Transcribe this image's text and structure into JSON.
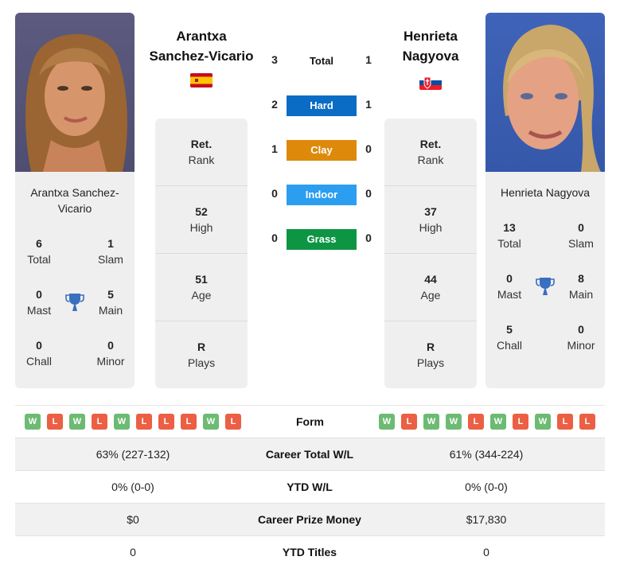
{
  "players": [
    {
      "name": "Arantxa Sanchez-Vicario",
      "name_header_line1": "Arantxa",
      "name_header_line2": "Sanchez-Vicario",
      "card_name": "Arantxa Sanchez-Vicario",
      "country_flag": "spain-flag",
      "titles": {
        "total": {
          "value": "6",
          "label": "Total"
        },
        "slam": {
          "value": "1",
          "label": "Slam"
        },
        "mast": {
          "value": "0",
          "label": "Mast"
        },
        "main": {
          "value": "5",
          "label": "Main"
        },
        "chall": {
          "value": "0",
          "label": "Chall"
        },
        "minor": {
          "value": "0",
          "label": "Minor"
        }
      },
      "info": {
        "rank": {
          "value": "Ret.",
          "label": "Rank"
        },
        "high": {
          "value": "52",
          "label": "High"
        },
        "age": {
          "value": "51",
          "label": "Age"
        },
        "plays": {
          "value": "R",
          "label": "Plays"
        }
      },
      "form": [
        "W",
        "L",
        "W",
        "L",
        "W",
        "L",
        "L",
        "L",
        "W",
        "L"
      ]
    },
    {
      "name": "Henrieta Nagyova",
      "name_header_line1": "Henrieta",
      "name_header_line2": "Nagyova",
      "card_name": "Henrieta Nagyova",
      "country_flag": "slovakia-flag",
      "titles": {
        "total": {
          "value": "13",
          "label": "Total"
        },
        "slam": {
          "value": "0",
          "label": "Slam"
        },
        "mast": {
          "value": "0",
          "label": "Mast"
        },
        "main": {
          "value": "8",
          "label": "Main"
        },
        "chall": {
          "value": "5",
          "label": "Chall"
        },
        "minor": {
          "value": "0",
          "label": "Minor"
        }
      },
      "info": {
        "rank": {
          "value": "Ret.",
          "label": "Rank"
        },
        "high": {
          "value": "37",
          "label": "High"
        },
        "age": {
          "value": "44",
          "label": "Age"
        },
        "plays": {
          "value": "R",
          "label": "Plays"
        }
      },
      "form": [
        "W",
        "L",
        "W",
        "W",
        "L",
        "W",
        "L",
        "W",
        "L",
        "L"
      ]
    }
  ],
  "h2h": {
    "total": {
      "label": "Total",
      "left": "3",
      "right": "1"
    },
    "surfaces": [
      {
        "label": "Hard",
        "left": "2",
        "right": "1",
        "color": "#0a6cc4"
      },
      {
        "label": "Clay",
        "left": "1",
        "right": "0",
        "color": "#dd8a0a"
      },
      {
        "label": "Indoor",
        "left": "0",
        "right": "0",
        "color": "#2b9ef0"
      },
      {
        "label": "Grass",
        "left": "0",
        "right": "0",
        "color": "#0d9544"
      }
    ]
  },
  "form_label": "Form",
  "stats": [
    {
      "label": "Career Total W/L",
      "left": "63% (227-132)",
      "right": "61% (344-224)"
    },
    {
      "label": "YTD W/L",
      "left": "0% (0-0)",
      "right": "0% (0-0)"
    },
    {
      "label": "Career Prize Money",
      "left": "$0",
      "right": "$17,830"
    },
    {
      "label": "YTD Titles",
      "left": "0",
      "right": "0"
    }
  ],
  "colors": {
    "win": "#6dbb73",
    "loss": "#ec5f44",
    "trophy": "#3a6fc0",
    "card_bg": "#efefef"
  }
}
